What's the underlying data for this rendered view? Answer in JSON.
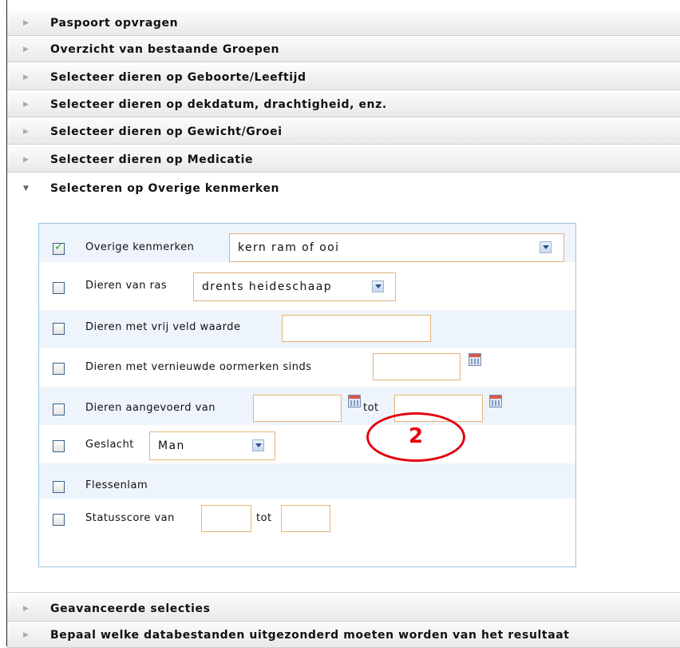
{
  "sections_top": [
    {
      "label": "Paspoort opvragen"
    },
    {
      "label": "Overzicht van bestaande Groepen"
    },
    {
      "label": "Selecteer dieren op Geboorte/Leeftijd"
    },
    {
      "label": "Selecteer dieren op dekdatum, drachtigheid, enz."
    },
    {
      "label": "Selecteer dieren op Gewicht/Groei"
    },
    {
      "label": "Selecteer dieren op Medicatie"
    }
  ],
  "open_section": {
    "label": "Selecteren op Overige kenmerken",
    "rows": {
      "overige": {
        "label": "Overige kenmerken",
        "checked": true,
        "select_value": "kern ram of ooi"
      },
      "ras": {
        "label": "Dieren van ras",
        "checked": false,
        "select_value": "drents heideschaap"
      },
      "vrij_veld": {
        "label": "Dieren met vrij veld waarde",
        "checked": false,
        "value": ""
      },
      "oormerken": {
        "label": "Dieren met vernieuwde oormerken sinds",
        "checked": false,
        "value": ""
      },
      "aangevoerd": {
        "label": "Dieren aangevoerd van",
        "tot_label": "tot",
        "checked": false,
        "from": "",
        "to": ""
      },
      "geslacht": {
        "label": "Geslacht",
        "checked": false,
        "select_value": "Man"
      },
      "flessenlam": {
        "label": "Flessenlam",
        "checked": false
      },
      "statusscore": {
        "label": "Statusscore van",
        "tot_label": "tot",
        "checked": false,
        "from": "",
        "to": ""
      }
    }
  },
  "sections_bottom": [
    {
      "label": "Geavanceerde selecties"
    },
    {
      "label": "Bepaal welke databestanden uitgezonderd moeten worden van het resultaat"
    }
  ],
  "annotation": {
    "number": "2",
    "color": "#e4000f"
  },
  "icons": {
    "collapsed": "triangle-right-icon",
    "expanded": "triangle-down-icon",
    "calendar": "calendar-icon",
    "dropdown": "chevron-down-icon"
  }
}
